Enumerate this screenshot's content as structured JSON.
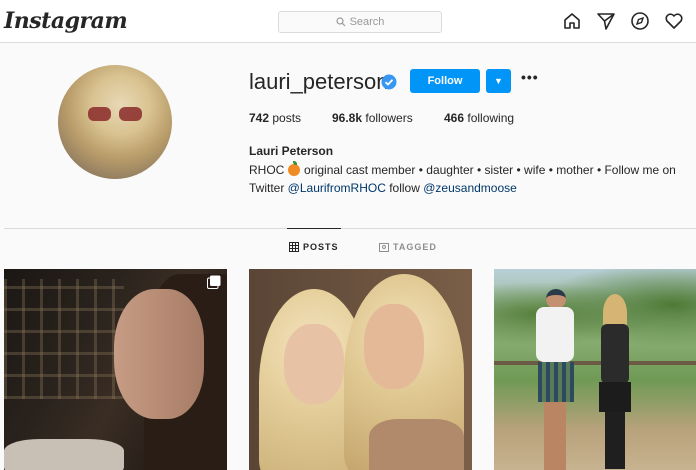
{
  "app": {
    "logo": "Instagram"
  },
  "search": {
    "placeholder": "Search"
  },
  "nav": {
    "icons": [
      "home-icon",
      "direct-icon",
      "explore-icon",
      "activity-icon"
    ]
  },
  "profile": {
    "username": "lauri_peterson",
    "verified": true,
    "follow_label": "Follow",
    "stats": {
      "posts_count": "742",
      "posts_label": "posts",
      "followers_count": "96.8k",
      "followers_label": "followers",
      "following_count": "466",
      "following_label": "following"
    },
    "full_name": "Lauri Peterson",
    "bio": {
      "prefix": "RHOC",
      "text1": " original cast member • daughter • sister • wife • mother • Follow me on Twitter ",
      "link1": "@LaurifromRHOC",
      "text2": " follow ",
      "link2": "@zeusandmoose"
    }
  },
  "tabs": [
    {
      "label": "POSTS",
      "active": true
    },
    {
      "label": "TAGGED",
      "active": false
    }
  ],
  "colors": {
    "accent": "#0095f6",
    "link": "#00376b",
    "verified": "#3897f0"
  }
}
